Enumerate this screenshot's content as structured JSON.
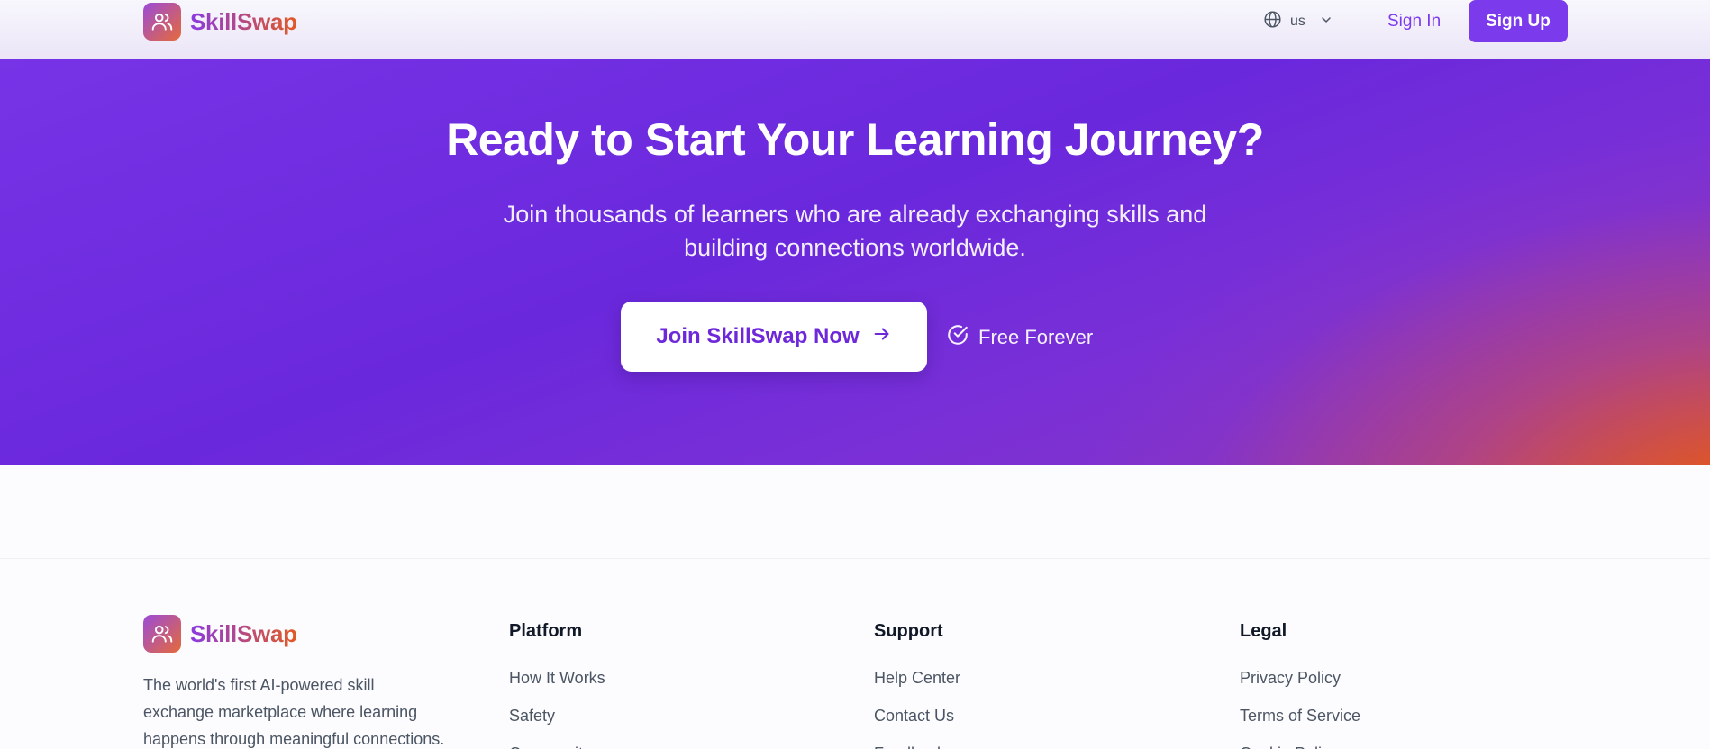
{
  "brand": {
    "name": "SkillSwap",
    "icon": "users-icon"
  },
  "header": {
    "language": {
      "icon": "globe-icon",
      "value": "us",
      "chevron": "chevron-down-icon"
    },
    "sign_in": "Sign In",
    "sign_up": "Sign Up"
  },
  "hero": {
    "title": "Ready to Start Your Learning Journey?",
    "subtitle_line1": "Join thousands of learners who are already exchanging skills and",
    "subtitle_line2": "building connections worldwide.",
    "cta_label": "Join SkillSwap Now",
    "cta_icon": "arrow-right-icon",
    "badge_icon": "check-circle-icon",
    "badge_label": "Free Forever"
  },
  "footer": {
    "description_line1": "The world's first AI-powered skill",
    "description_line2": "exchange marketplace where learning",
    "description_line3": "happens through meaningful connections.",
    "columns": [
      {
        "title": "Platform",
        "links": [
          "How It Works",
          "Safety",
          "Community"
        ]
      },
      {
        "title": "Support",
        "links": [
          "Help Center",
          "Contact Us",
          "Feedback"
        ]
      },
      {
        "title": "Legal",
        "links": [
          "Privacy Policy",
          "Terms of Service",
          "Cookie Policy"
        ]
      }
    ]
  },
  "colors": {
    "accent": "#7c3aed",
    "brand_orange": "#e25a22"
  }
}
